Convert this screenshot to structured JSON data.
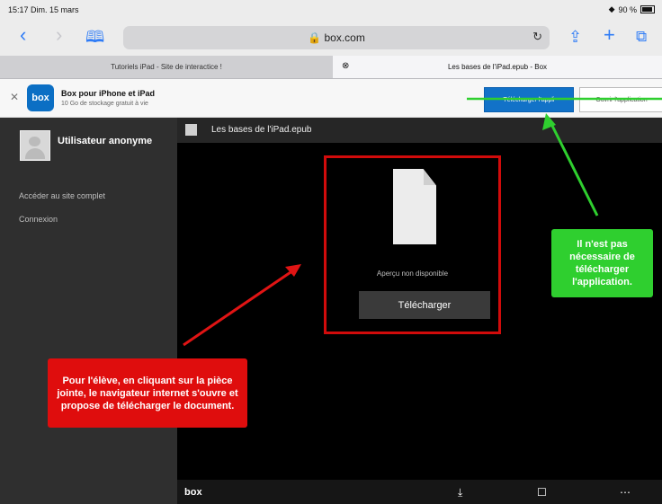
{
  "status": {
    "time": "15:17",
    "date": "Dim. 15 mars",
    "battery": "90 %"
  },
  "toolbar": {
    "domain": "box.com"
  },
  "tabs": [
    {
      "label": "Tutoriels iPad - Site de interactice !"
    },
    {
      "label": "Les bases de l'iPad.epub - Box"
    }
  ],
  "banner": {
    "logo_text": "box",
    "title": "Box pour iPhone et iPad",
    "subtitle": "10 Go de stockage gratuit à vie",
    "download_label": "Télécharger l'appli",
    "open_label": "Ouvrir l'application"
  },
  "sidebar": {
    "username": "Utilisateur anonyme",
    "links": [
      {
        "label": "Accéder au site complet"
      },
      {
        "label": "Connexion"
      }
    ]
  },
  "viewer": {
    "filename": "Les bases de l'iPad.epub",
    "no_preview": "Aperçu non disponible",
    "download_label": "Télécharger"
  },
  "footer": {
    "brand": "box"
  },
  "annotations": {
    "red_text": "Pour l'élève, en cliquant sur la pièce jointe, le navigateur internet s'ouvre et propose de télécharger le document.",
    "green_text": "Il n'est pas nécessaire de télécharger l'application."
  },
  "colors": {
    "accent_blue": "#2f7cf6",
    "box_blue": "#0b6fc4",
    "red": "#df0d0d",
    "green": "#2fcf2f"
  }
}
